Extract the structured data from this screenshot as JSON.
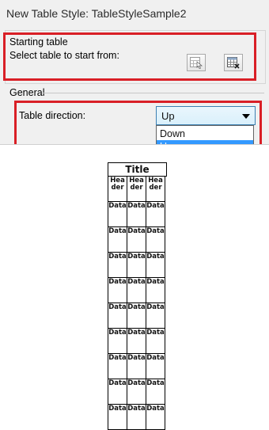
{
  "window": {
    "title": "New Table Style: TableStyleSample2"
  },
  "starting_table": {
    "group_label": "Starting table",
    "prompt": "Select table to start from:",
    "select_table_icon": "table-select-icon",
    "remove_table_icon": "table-remove-icon"
  },
  "general": {
    "group_label": "General",
    "direction_label": "Table direction:",
    "direction_value": "Up",
    "options": [
      "Down",
      "Up"
    ],
    "selected_option": "Up"
  },
  "preview": {
    "title": "Title",
    "headers": [
      "Header",
      "Header",
      "Header"
    ],
    "cell_text": "Data",
    "data_rows": 9
  },
  "colors": {
    "highlight": "#d91f26",
    "selection": "#3399ff"
  }
}
